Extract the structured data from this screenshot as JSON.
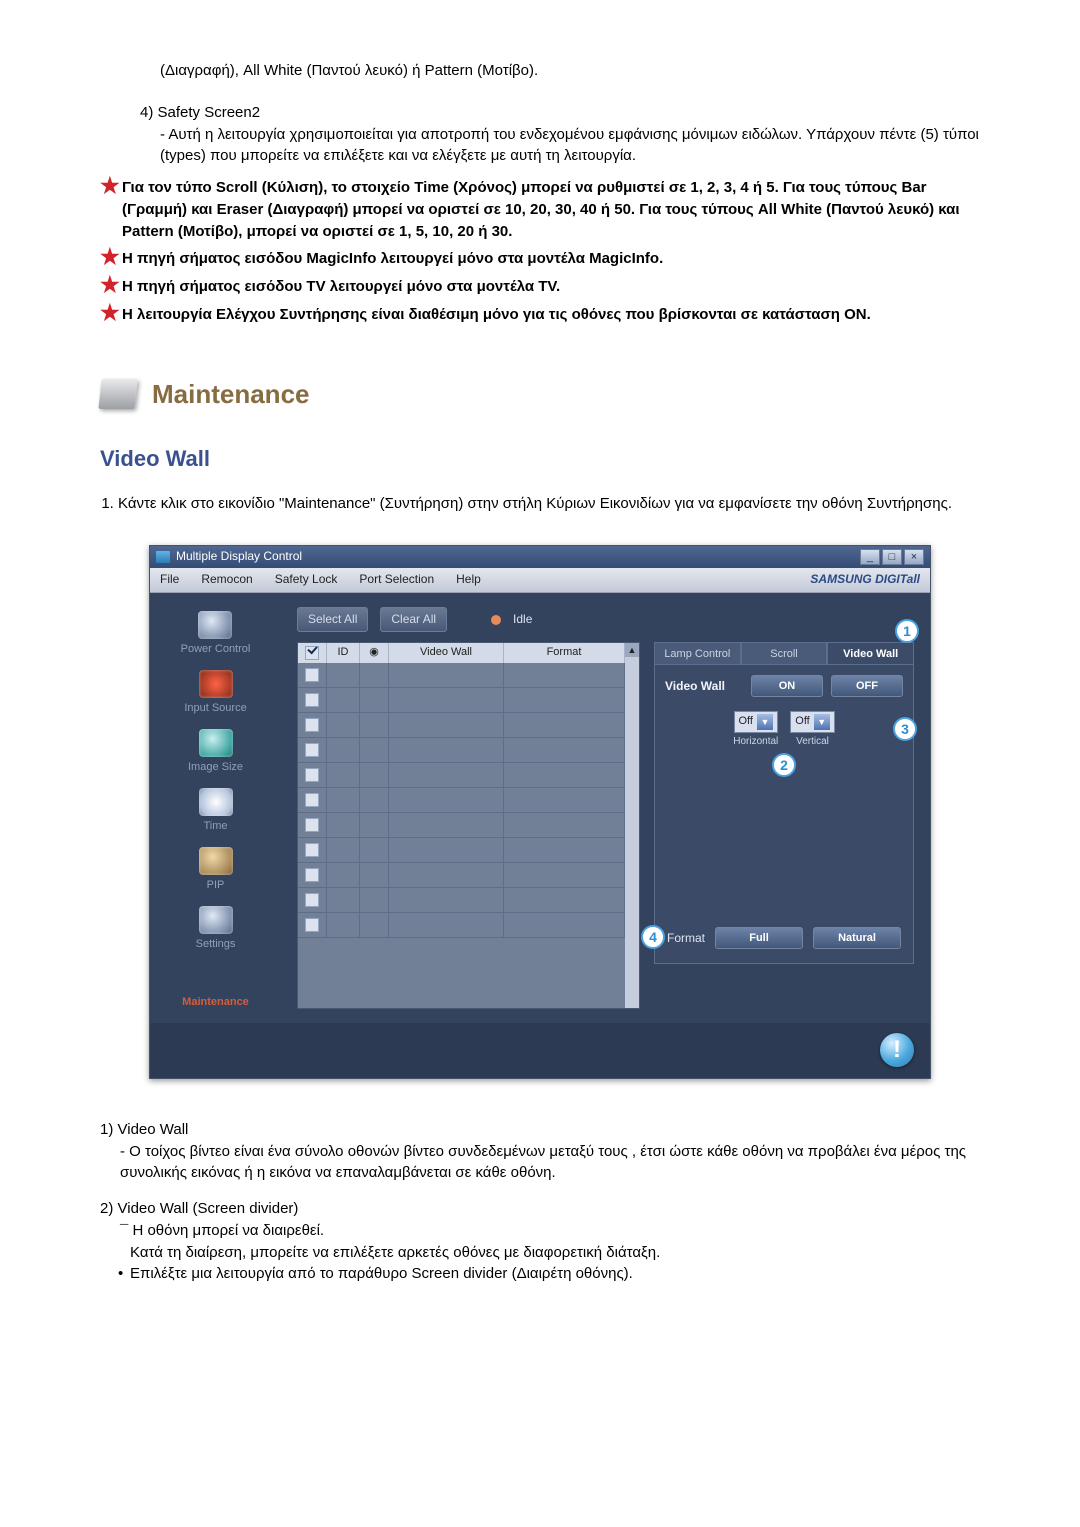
{
  "intro_line": "(Διαγραφή), All White (Παντού λευκό) ή Pattern (Μοτίβο).",
  "safety_num": "4)",
  "safety_title": "Safety Screen2",
  "safety_body": "- Αυτή η λειτουργία χρησιμοποιείται για αποτροπή του ενδεχομένου εμφάνισης μόνιμων ειδώλων. Υπάρχουν πέντε (5) τύποι (types) που μπορείτε να επιλέξετε και να ελέγξετε με αυτή τη λειτουργία.",
  "stars": [
    "Για τον τύπο Scroll (Κύλιση), το στοιχείο Time (Χρόνος) μπορεί να ρυθμιστεί σε 1, 2, 3, 4 ή 5. Για τους τύπους Bar (Γραμμή) και Eraser (Διαγραφή) μπορεί να οριστεί σε 10, 20, 30, 40 ή 50. Για τους τύπους All White (Παντού λευκό) και Pattern (Μοτίβο), μπορεί να οριστεί σε 1, 5, 10, 20 ή 30.",
    "Η πηγή σήματος εισόδου MagicInfo λειτουργεί μόνο στα μοντέλα MagicInfo.",
    "Η πηγή σήματος εισόδου TV λειτουργεί μόνο στα μοντέλα TV.",
    "Η λειτουργία Ελέγχου Συντήρησης είναι διαθέσιμη μόνο για τις οθόνες που βρίσκονται σε κατάσταση ON."
  ],
  "maintenance_heading": "Maintenance",
  "h1_blue": "Video Wall",
  "step1": "Κάντε κλικ στο εικονίδιο \"Maintenance\" (Συντήρηση) στην στήλη Κύριων Εικονιδίων για να εμφανίσετε την οθόνη Συντήρησης.",
  "mdc": {
    "window_title": "Multiple Display Control",
    "win_min": "_",
    "win_max": "□",
    "win_close": "×",
    "menu": {
      "file": "File",
      "remocon": "Remocon",
      "safety": "Safety Lock",
      "port": "Port Selection",
      "help": "Help",
      "brand": "SAMSUNG DIGITall"
    },
    "select_all": "Select All",
    "clear_all": "Clear All",
    "idle": "Idle",
    "th_id": "ID",
    "th_videowall": "Video Wall",
    "th_format": "Format",
    "sidebar": {
      "power": "Power Control",
      "input": "Input Source",
      "image": "Image Size",
      "time": "Time",
      "pip": "PIP",
      "settings": "Settings",
      "maintenance": "Maintenance"
    },
    "tabs": {
      "lamp": "Lamp Control",
      "scroll": "Scroll",
      "videowall": "Video Wall"
    },
    "panel": {
      "vw_label": "Video Wall",
      "on": "ON",
      "off": "OFF",
      "dd_off": "Off",
      "horizontal": "Horizontal",
      "vertical": "Vertical",
      "format_label": "Format",
      "full": "Full",
      "natural": "Natural"
    },
    "circ": {
      "c1": "1",
      "c2": "2",
      "c3": "3",
      "c4": "4"
    }
  },
  "def1_num": "1)",
  "def1_title": "Video Wall",
  "def1_text": "- Ο τοίχος βίντεο είναι ένα σύνολο οθονών βίντεο συνδεδεμένων μεταξύ τους , έτσι ώστε κάθε οθόνη να προβάλει ένα μέρος της συνολικής εικόνας ή η εικόνα να επαναλαμβάνεται σε κάθε οθόνη.",
  "def2_num": "2)",
  "def2_title": "Video Wall (Screen divider)",
  "def2_line1": "¯ Η οθόνη μπορεί να διαιρεθεί.",
  "def2_line2": "Κατά τη διαίρεση, μπορείτε να επιλέξετε αρκετές οθόνες με διαφορετική διάταξη.",
  "def2_bullet": "Επιλέξτε μια λειτουργία από το παράθυρο Screen divider (Διαιρέτη οθόνης)."
}
